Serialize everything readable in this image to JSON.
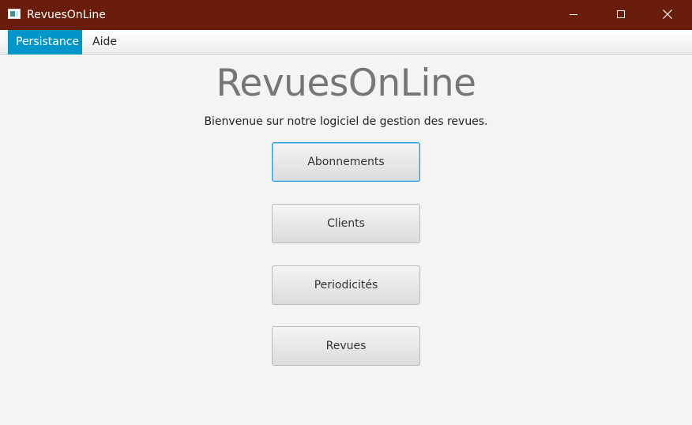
{
  "window": {
    "title": "RevuesOnLine",
    "controls": {
      "minimize": "minimize-icon",
      "maximize": "maximize-icon",
      "close": "close-icon"
    },
    "colors": {
      "titlebar": "#6b1d0b",
      "menu_active": "#0096c9"
    }
  },
  "menubar": {
    "items": [
      {
        "label": "Persistance",
        "active": true
      },
      {
        "label": "Aide",
        "active": false
      }
    ]
  },
  "main": {
    "title": "RevuesOnLine",
    "subtitle": "Bienvenue sur notre logiciel de gestion des revues.",
    "buttons": [
      {
        "label": "Abonnements",
        "focused": true
      },
      {
        "label": "Clients",
        "focused": false
      },
      {
        "label": "Periodicités",
        "focused": false
      },
      {
        "label": "Revues",
        "focused": false
      }
    ]
  }
}
